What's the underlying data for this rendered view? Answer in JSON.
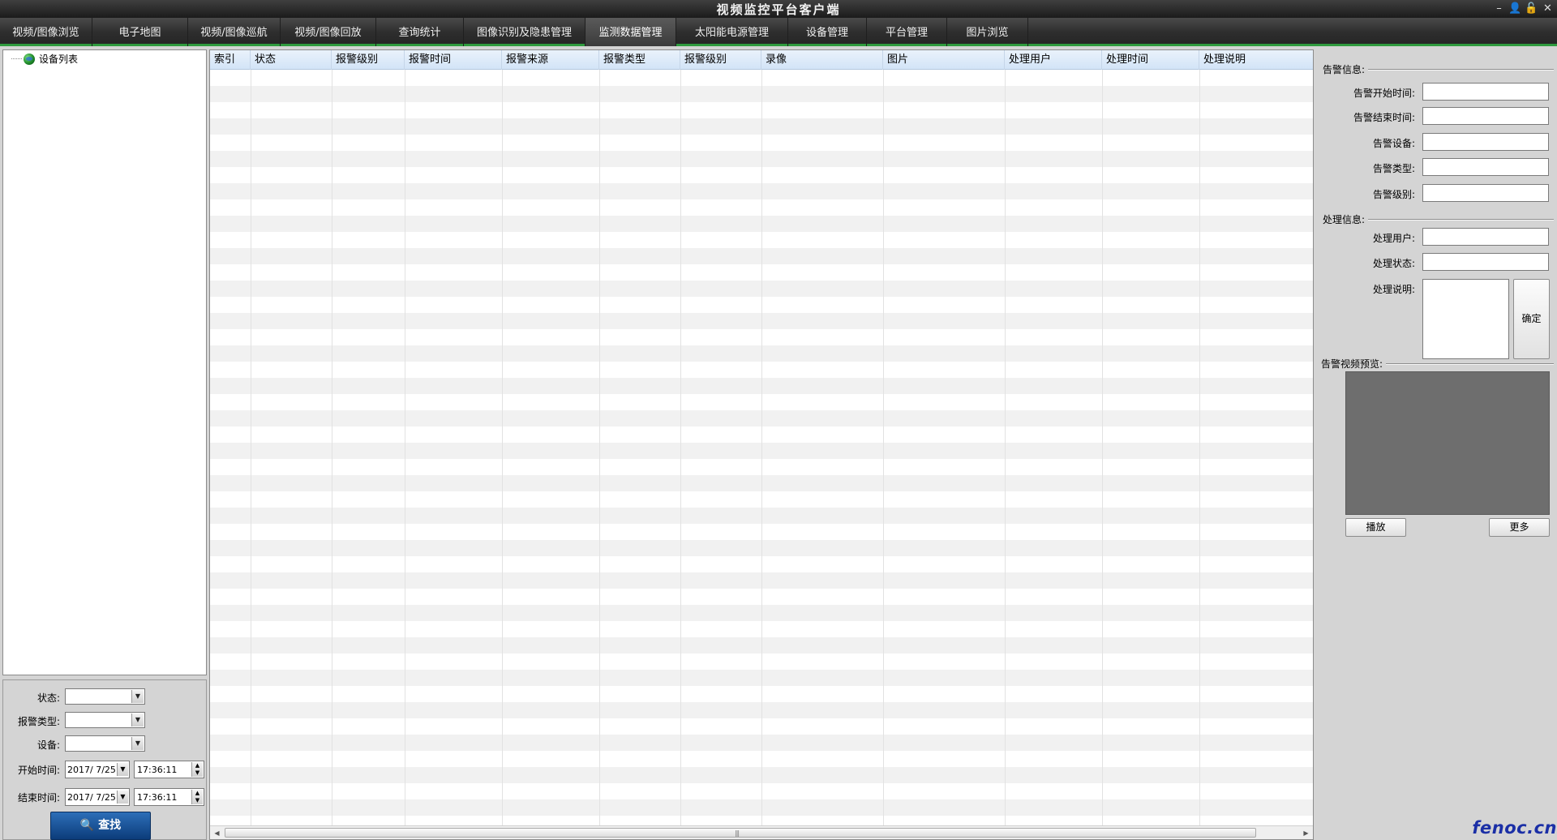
{
  "window": {
    "title": "视频监控平台客户端",
    "controls": [
      "–",
      "👤",
      "🔓",
      "✕"
    ]
  },
  "menu": {
    "tabs": [
      {
        "label": "视频/图像浏览"
      },
      {
        "label": "电子地图"
      },
      {
        "label": "视频/图像巡航"
      },
      {
        "label": "视频/图像回放"
      },
      {
        "label": "查询统计"
      },
      {
        "label": "图像识别及隐患管理"
      },
      {
        "label": "监测数据管理"
      },
      {
        "label": "太阳能电源管理"
      },
      {
        "label": "设备管理"
      },
      {
        "label": "平台管理"
      },
      {
        "label": "图片浏览"
      }
    ],
    "active_index": 6,
    "accent_color": "#2f9a3e"
  },
  "tree": {
    "root_label": "设备列表",
    "root_icon": "globe-icon"
  },
  "filters": {
    "status_label": "状态:",
    "status_value": "",
    "alarm_type_label": "报警类型:",
    "alarm_type_value": "",
    "device_label": "设备:",
    "device_value": "",
    "start_label": "开始时间:",
    "start_date": "2017/ 7/25",
    "start_time": "17:36:11",
    "end_label": "结束时间:",
    "end_date": "2017/ 7/25",
    "end_time": "17:36:11",
    "search_button": "查找",
    "search_icon": "magnifier-icon"
  },
  "table": {
    "columns": [
      "索引",
      "状态",
      "报警级别",
      "报警时间",
      "报警来源",
      "报警类型",
      "报警级别",
      "录像",
      "图片",
      "处理用户",
      "处理时间",
      "处理说明"
    ],
    "rows": []
  },
  "alarm_info": {
    "section_label": "告警信息:",
    "start_time_label": "告警开始时间:",
    "end_time_label": "告警结束时间:",
    "device_label": "告警设备:",
    "type_label": "告警类型:",
    "level_label": "告警级别:"
  },
  "handle_info": {
    "section_label": "处理信息:",
    "user_label": "处理用户:",
    "status_label": "处理状态:",
    "note_label": "处理说明:",
    "confirm_button": "确定"
  },
  "preview": {
    "section_label": "告警视频预览:",
    "play_button": "播放",
    "more_button": "更多"
  },
  "watermark": "fenoc.cn"
}
